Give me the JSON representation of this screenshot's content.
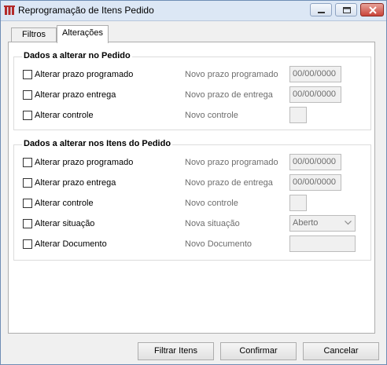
{
  "window": {
    "title": "Reprogramação de Itens Pedido"
  },
  "tabs": [
    {
      "label": "Filtros"
    },
    {
      "label": "Alterações"
    }
  ],
  "group_pedido": {
    "title": "Dados a alterar no Pedido",
    "rows": [
      {
        "checkbox_label": "Alterar prazo programado",
        "field_label": "Novo prazo programado",
        "value": "00/00/0000"
      },
      {
        "checkbox_label": "Alterar prazo entrega",
        "field_label": "Novo prazo de entrega",
        "value": "00/00/0000"
      },
      {
        "checkbox_label": "Alterar controle",
        "field_label": "Novo controle",
        "value": ""
      }
    ]
  },
  "group_itens": {
    "title": "Dados a alterar nos Itens do Pedido",
    "rows": [
      {
        "checkbox_label": "Alterar prazo programado",
        "field_label": "Novo prazo programado",
        "value": "00/00/0000"
      },
      {
        "checkbox_label": "Alterar prazo entrega",
        "field_label": "Novo prazo de entrega",
        "value": "00/00/0000"
      },
      {
        "checkbox_label": "Alterar controle",
        "field_label": "Novo controle",
        "value": ""
      },
      {
        "checkbox_label": "Alterar situação",
        "field_label": "Nova situação",
        "value": "Aberto"
      },
      {
        "checkbox_label": "Alterar Documento",
        "field_label": "Novo Documento",
        "value": ""
      }
    ]
  },
  "buttons": {
    "filtrar": "Filtrar Itens",
    "confirmar": "Confirmar",
    "cancelar": "Cancelar"
  },
  "colors": {
    "title_bar": "#dce7f5",
    "close_button": "#c9443a",
    "app_icon": "#b32a2a"
  }
}
